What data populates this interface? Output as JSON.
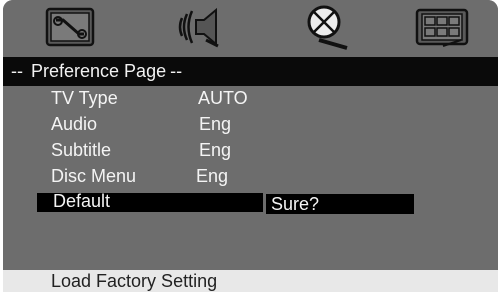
{
  "icons": [
    {
      "name": "system-setup-icon"
    },
    {
      "name": "audio-setup-icon"
    },
    {
      "name": "video-setup-icon"
    },
    {
      "name": "preference-setup-icon"
    }
  ],
  "title": {
    "prefix": "--",
    "label": "Preference Page",
    "suffix": "--"
  },
  "menu": [
    {
      "name": "TV Type",
      "value": "AUTO"
    },
    {
      "name": "Audio",
      "value": "Eng"
    },
    {
      "name": "Subtitle",
      "value": "Eng"
    },
    {
      "name": "Disc Menu",
      "value": "Eng"
    },
    {
      "name": "Default",
      "value": ""
    }
  ],
  "confirm": "Sure?",
  "status": "Load Factory Setting",
  "colors": {
    "background": "#6d6d6d",
    "highlight": "#000000",
    "text": "#f4f4f4",
    "status_bar": "#e8e8e8"
  }
}
